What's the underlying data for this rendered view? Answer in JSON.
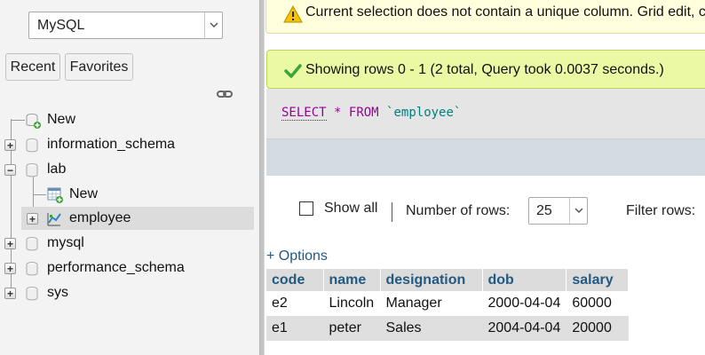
{
  "navigation": {
    "server_select": {
      "value": "MySQL"
    },
    "tabs": {
      "recent": "Recent",
      "favorites": "Favorites"
    },
    "tree": {
      "new": "New",
      "information_schema": "information_schema",
      "lab": "lab",
      "lab_new": "New",
      "lab_employee": "employee",
      "mysql": "mysql",
      "performance_schema": "performance_schema",
      "sys": "sys"
    }
  },
  "main": {
    "warning_message": "Current selection does not contain a unique column. Grid edit, checkbox, Edit, Copy and Delete features are not available.",
    "success_message": "Showing rows 0 - 1 (2 total, Query took 0.0037 seconds.)",
    "sql": {
      "select": "SELECT",
      "star": "*",
      "from": "FROM",
      "table": "`employee`"
    },
    "controls": {
      "show_all": "Show all",
      "number_of_rows_label": "Number of rows:",
      "number_of_rows_value": "25",
      "filter_rows_label": "Filter rows:",
      "options_link": "+ Options"
    },
    "results": {
      "columns": [
        "code",
        "name",
        "designation",
        "dob",
        "salary"
      ],
      "rows": [
        [
          "e2",
          "Lincoln",
          "Manager",
          "2000-04-04",
          "60000"
        ],
        [
          "e1",
          "peter",
          "Sales",
          "2004-04-04",
          "20000"
        ]
      ]
    }
  },
  "colors": {
    "link": "#235a81",
    "sql_keyword": "#990099",
    "sql_identifier": "#008080",
    "warning_bg": "#ffffdd",
    "success_bg": "#ebf8a4",
    "selected_row": "#dcdcdc"
  },
  "icons": {
    "warning": "warning-icon",
    "success": "checkmark-icon",
    "database": "database-icon",
    "table": "table-icon",
    "new": "new-plus-icon",
    "link": "link-icon"
  }
}
